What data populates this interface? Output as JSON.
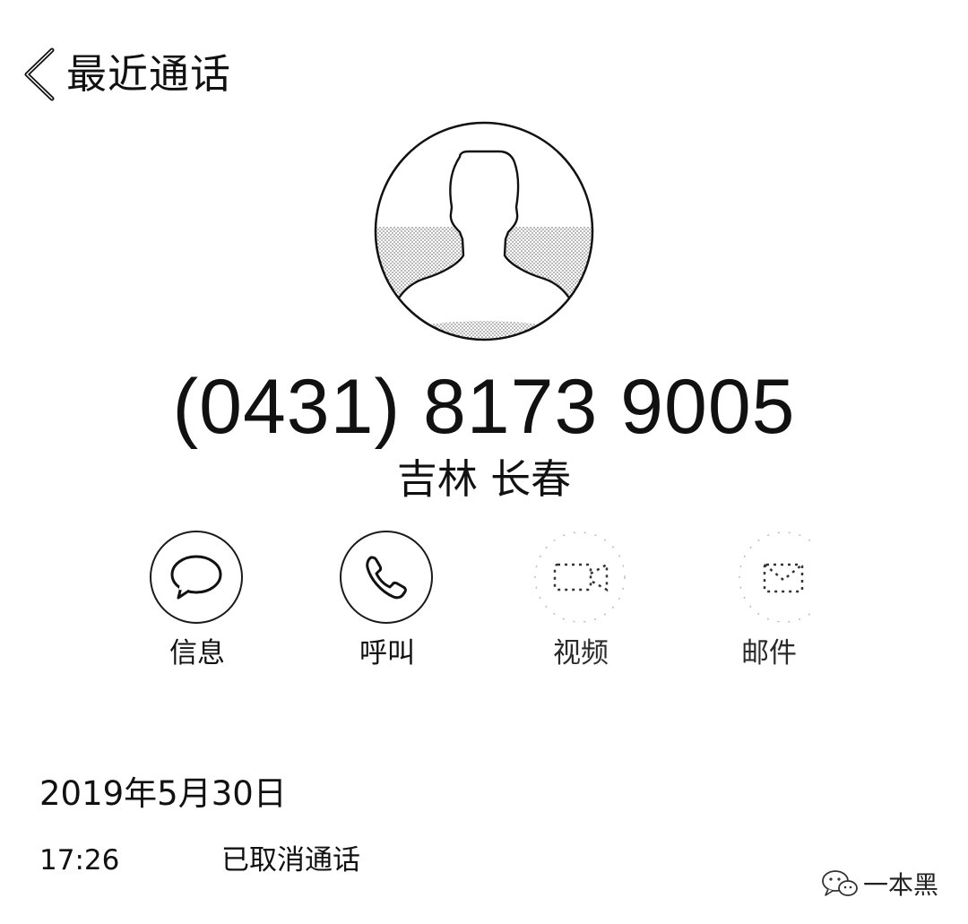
{
  "nav": {
    "back_label": "最近通话",
    "back_icon": "chevron-left-icon"
  },
  "contact": {
    "avatar_icon": "person-silhouette-icon",
    "phone_number": "(0431) 8173 9005",
    "location": "吉林 长春"
  },
  "actions": [
    {
      "label": "信息",
      "icon": "message-bubble-icon",
      "enabled": true
    },
    {
      "label": "呼叫",
      "icon": "phone-handset-icon",
      "enabled": true
    },
    {
      "label": "视频",
      "icon": "video-camera-icon",
      "enabled": false
    },
    {
      "label": "邮件",
      "icon": "mail-envelope-icon",
      "enabled": false
    }
  ],
  "call_log": {
    "date": "2019年5月30日",
    "entries": [
      {
        "time": "17:26",
        "status": "已取消通话"
      }
    ]
  },
  "watermark": {
    "icon": "wechat-icon",
    "text": "一本黑"
  },
  "colors": {
    "text": "#111111",
    "background": "#ffffff",
    "icon_stroke": "#1a1a1a"
  }
}
